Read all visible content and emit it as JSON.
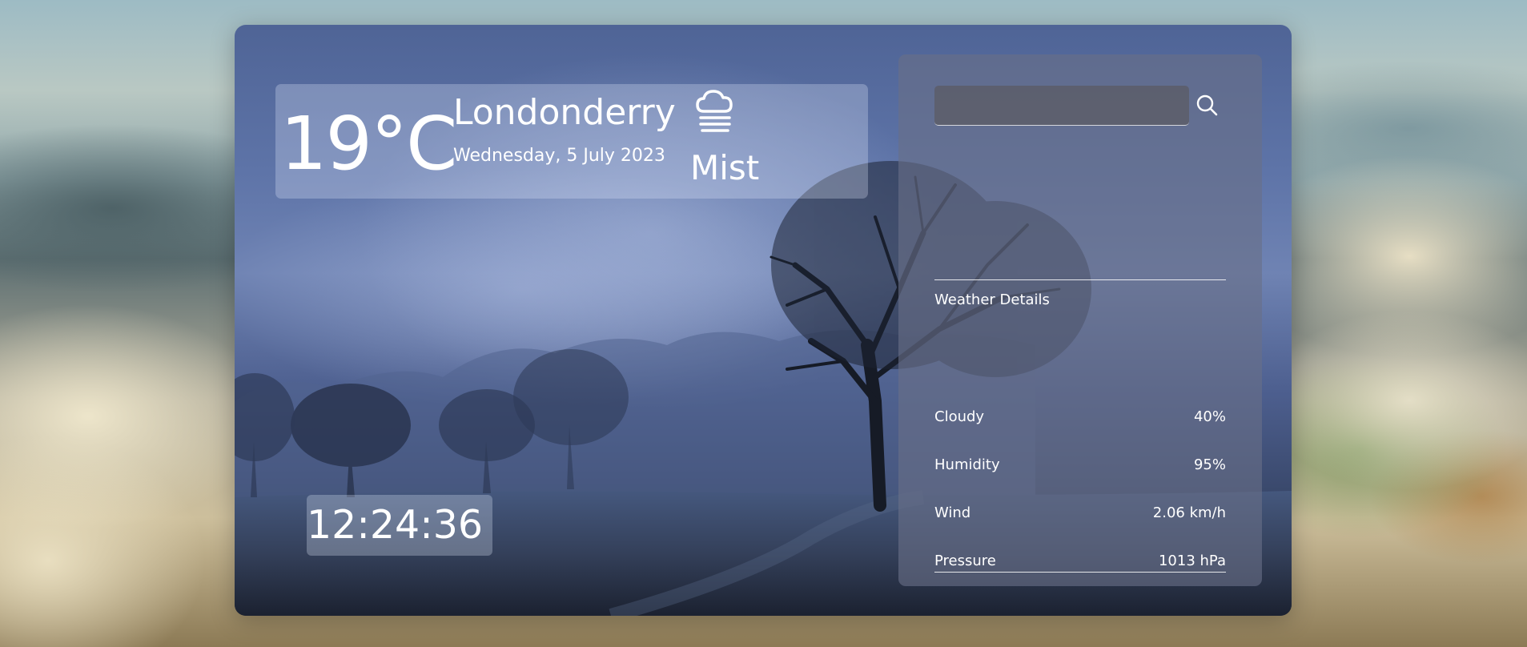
{
  "current": {
    "temperature": "19°C",
    "city": "Londonderry",
    "date": "Wednesday, 5 July 2023",
    "condition": "Mist",
    "condition_icon": "mist-icon"
  },
  "clock": {
    "time": "12:24:36"
  },
  "search": {
    "placeholder": "",
    "value": "",
    "icon": "search-icon"
  },
  "details": {
    "title": "Weather Details",
    "rows": [
      {
        "label": "Cloudy",
        "value": "40%"
      },
      {
        "label": "Humidity",
        "value": "95%"
      },
      {
        "label": "Wind",
        "value": "2.06 km/h"
      },
      {
        "label": "Pressure",
        "value": "1013 hPa"
      }
    ]
  },
  "colors": {
    "card_top": "#4f6496",
    "panel": "#697087",
    "text": "#ffffff"
  }
}
